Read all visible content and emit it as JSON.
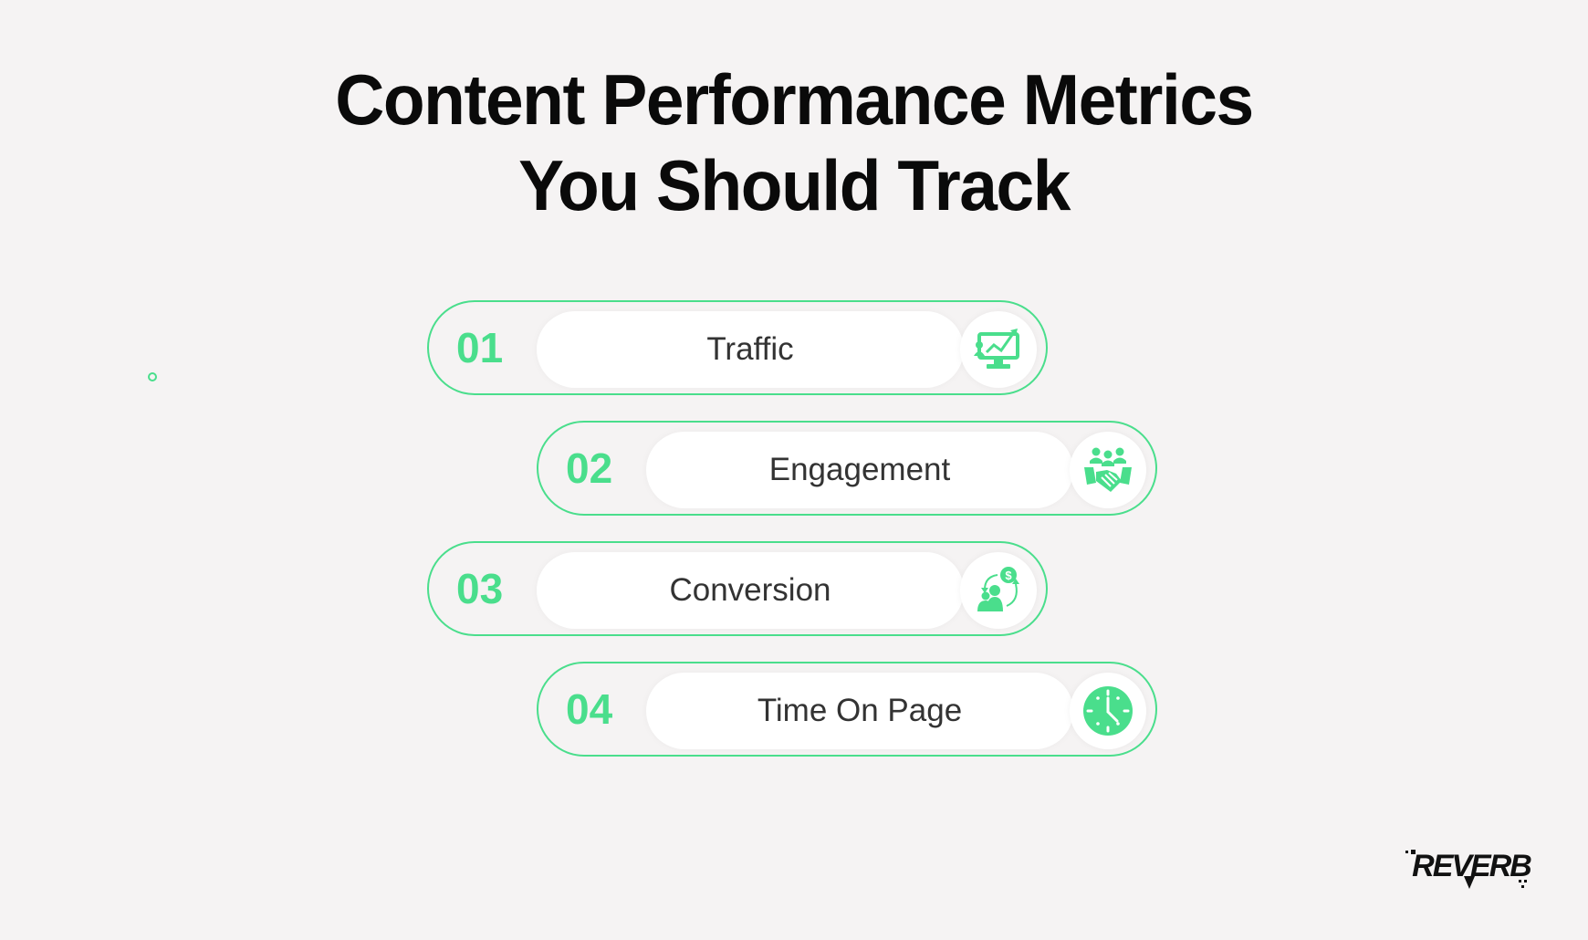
{
  "title": {
    "line1": "Content Performance Metrics",
    "line2": "You Should Track"
  },
  "accent_color": "#4ade8c",
  "metrics": [
    {
      "number": "01",
      "label": "Traffic",
      "icon": "monitor-growth-chart-icon"
    },
    {
      "number": "02",
      "label": "Engagement",
      "icon": "team-handshake-icon"
    },
    {
      "number": "03",
      "label": "Conversion",
      "icon": "customer-dollar-cycle-icon"
    },
    {
      "number": "04",
      "label": "Time On Page",
      "icon": "clock-icon"
    }
  ],
  "logo": {
    "text": "REVERB"
  }
}
